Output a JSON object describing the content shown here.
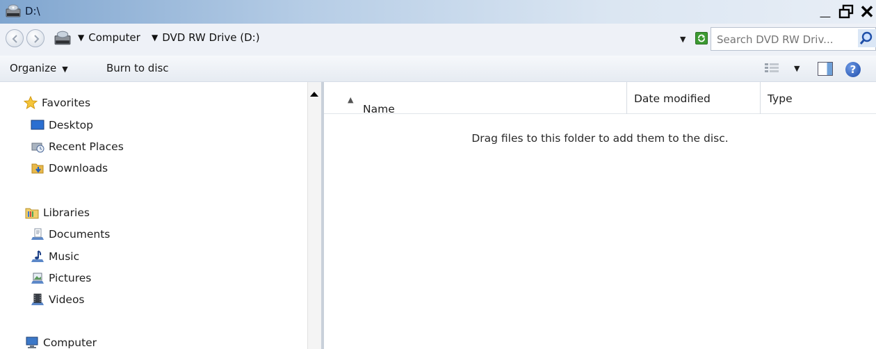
{
  "window": {
    "title": "D:\\",
    "minimize_label": "_",
    "close_label": "✕"
  },
  "address_bar": {
    "breadcrumbs": [
      "Computer",
      "DVD RW Drive (D:)"
    ],
    "search_placeholder": "Search DVD RW Driv..."
  },
  "toolbar": {
    "organize_label": "Organize",
    "burn_label": "Burn to disc",
    "help_label": "?"
  },
  "navigation": {
    "favorites": {
      "label": "Favorites",
      "items": [
        "Desktop",
        "Recent Places",
        "Downloads"
      ]
    },
    "libraries": {
      "label": "Libraries",
      "items": [
        "Documents",
        "Music",
        "Pictures",
        "Videos"
      ]
    },
    "computer": {
      "label": "Computer"
    }
  },
  "content": {
    "columns": [
      "Name",
      "Date modified",
      "Type"
    ],
    "sort_indicator": "▲",
    "empty_message": "Drag files to this folder to add them to the disc."
  },
  "colors": {
    "titlebar_accent": "#7fa5cf",
    "refresh_green": "#3c9a32",
    "help_blue": "#1c4aa8"
  },
  "icons": {
    "title": "dvd-drive-icon",
    "back": "back-arrow-icon",
    "forward": "forward-arrow-icon",
    "refresh": "refresh-icon",
    "search": "search-icon",
    "view": "view-options-icon",
    "preview_pane": "preview-pane-icon",
    "help": "help-icon"
  }
}
